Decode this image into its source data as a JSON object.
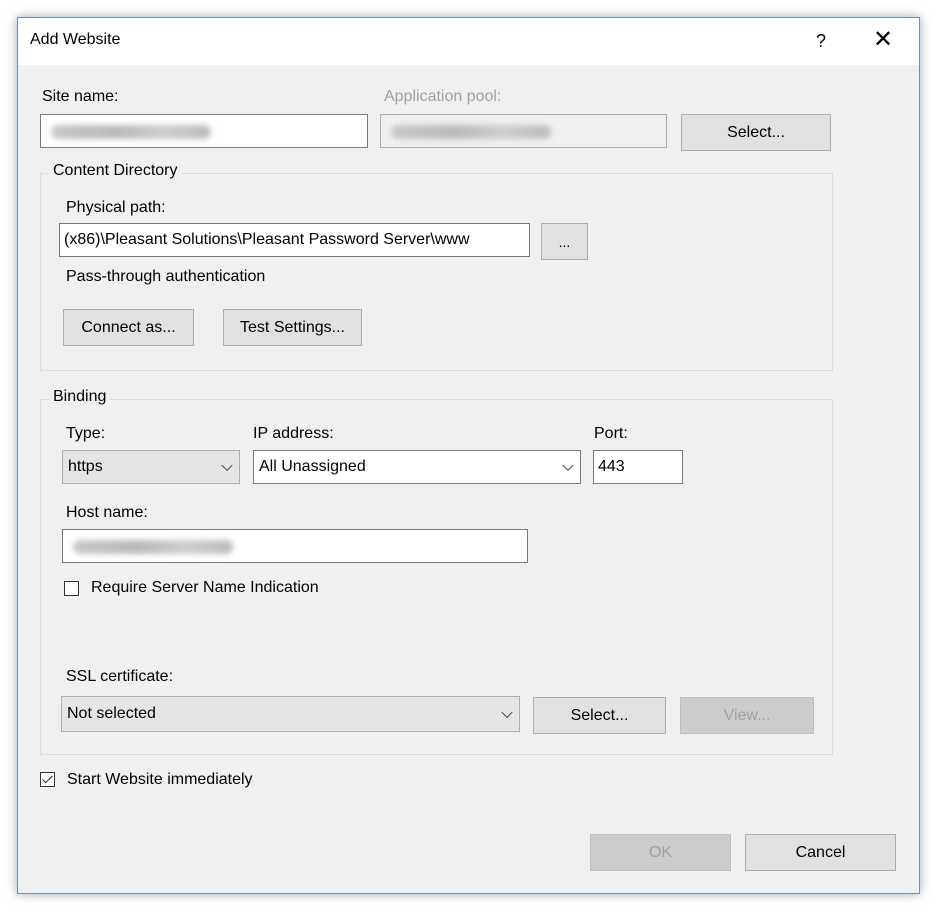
{
  "window": {
    "title": "Add Website",
    "help_label": "?",
    "close_label": "✕"
  },
  "site": {
    "name_label": "Site name:",
    "app_pool_label": "Application pool:",
    "select_label": "Select..."
  },
  "content": {
    "group_label": "Content Directory",
    "physical_path_label": "Physical path:",
    "physical_path_value": "(x86)\\Pleasant Solutions\\Pleasant Password Server\\www",
    "browse_label": "...",
    "passthrough_label": "Pass-through authentication",
    "connect_as_label": "Connect as...",
    "test_settings_label": "Test Settings..."
  },
  "binding": {
    "group_label": "Binding",
    "type_label": "Type:",
    "type_value": "https",
    "ip_label": "IP address:",
    "ip_value": "All Unassigned",
    "port_label": "Port:",
    "port_value": "443",
    "host_label": "Host name:",
    "sni_label": "Require Server Name Indication",
    "sni_checked": false,
    "ssl_label": "SSL certificate:",
    "ssl_value": "Not selected",
    "ssl_select_label": "Select...",
    "ssl_view_label": "View..."
  },
  "footer": {
    "start_label": "Start Website immediately",
    "start_checked": true,
    "ok_label": "OK",
    "cancel_label": "Cancel"
  },
  "icons": {
    "help": "help-icon",
    "close": "close-icon",
    "dropdown": "chevron-down-icon",
    "check": "checkmark-icon"
  },
  "colors": {
    "dialog_bg": "#f0f0f0",
    "button_bg": "#e1e1e1",
    "disabled_text": "#a0a0a0",
    "border": "#6b8fb5"
  }
}
